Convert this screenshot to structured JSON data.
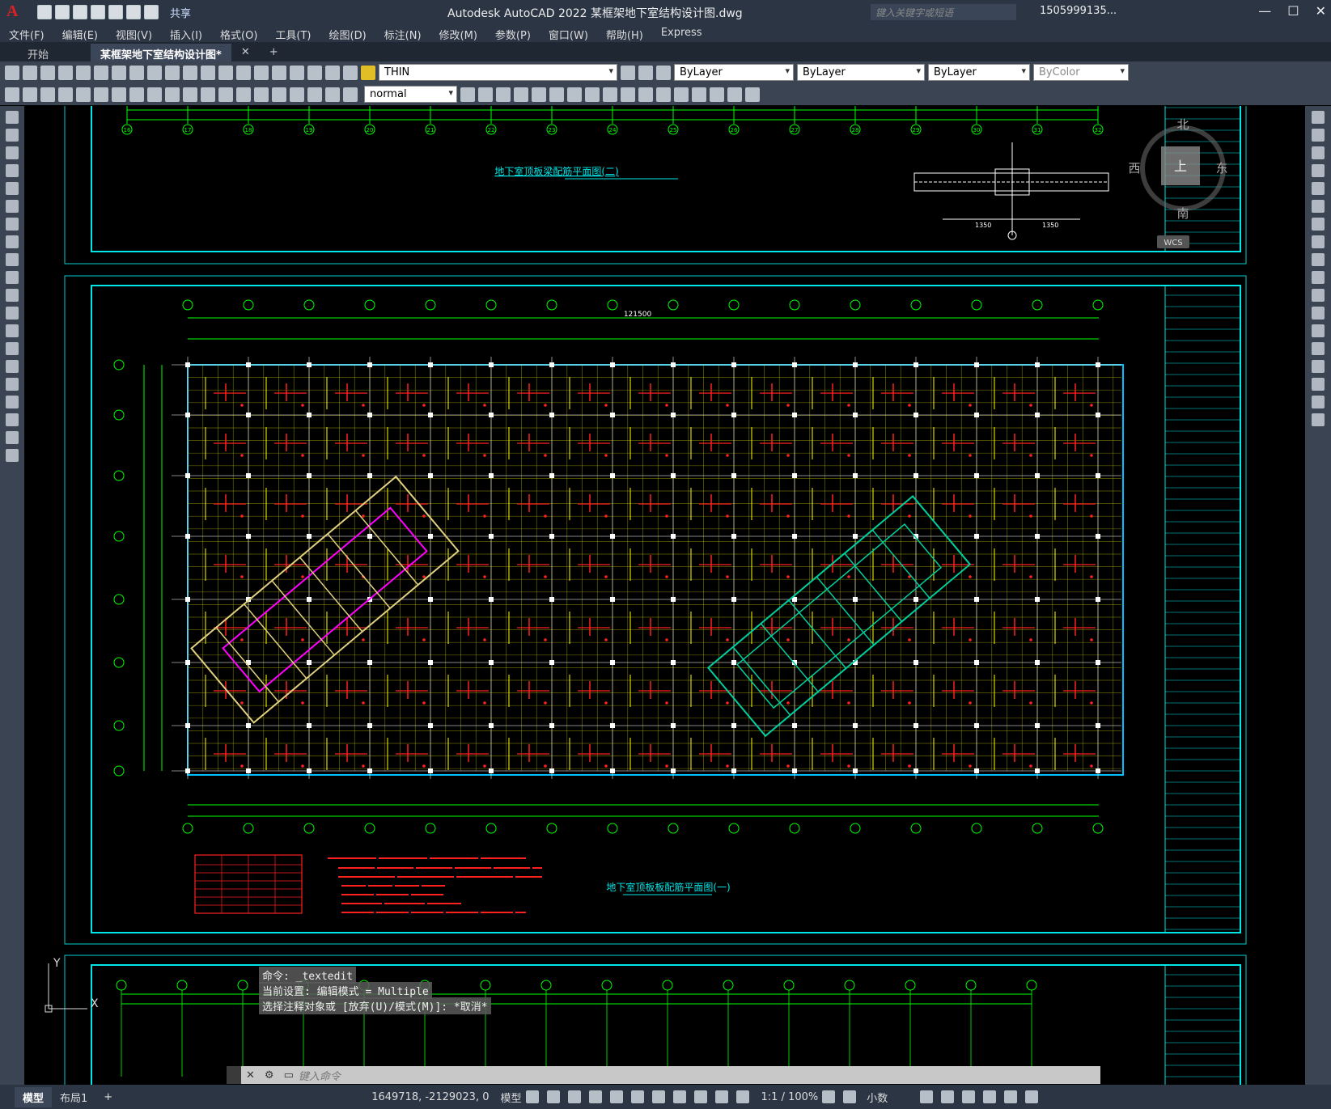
{
  "app": {
    "title": "Autodesk AutoCAD 2022    某框架地下室结构设计图.dwg",
    "share_label": "共享",
    "search_placeholder": "键入关键字或短语",
    "user": "1505999135..."
  },
  "menu": [
    "文件(F)",
    "编辑(E)",
    "视图(V)",
    "插入(I)",
    "格式(O)",
    "工具(T)",
    "绘图(D)",
    "标注(N)",
    "修改(M)",
    "参数(P)",
    "窗口(W)",
    "帮助(H)",
    "Express"
  ],
  "tabs": [
    {
      "label": "开始"
    },
    {
      "label": "某框架地下室结构设计图*"
    }
  ],
  "toolbar": {
    "layer": "THIN",
    "text_style": "normal",
    "color": "ByLayer",
    "linetype": "ByLayer",
    "lineweight": "ByLayer",
    "plotstyle": "ByColor"
  },
  "drawing": {
    "title1": "地下室顶板梁配筋平面图(二)",
    "title2": "地下室顶板板配筋平面图(一)",
    "dim_total": "121500",
    "axis_labels_top": [
      "16",
      "17",
      "18",
      "19",
      "20",
      "21",
      "22",
      "23",
      "24",
      "25",
      "26",
      "27",
      "28",
      "29",
      "30",
      "31",
      "32"
    ],
    "viewcube": {
      "north": "北",
      "south": "南",
      "east": "东",
      "west": "西",
      "top": "上",
      "wcs": "WCS"
    },
    "ucs": {
      "x": "X",
      "y": "Y"
    }
  },
  "command": {
    "history": [
      "命令: _textedit",
      "当前设置: 编辑模式 = Multiple",
      "选择注释对象或 [放弃(U)/模式(M)]: *取消*"
    ],
    "placeholder": "键入命令"
  },
  "status": {
    "tab_model": "模型",
    "tab_layout": "布局1",
    "coords": "1649718, -2129023, 0",
    "space": "模型",
    "scale": "1:1 / 100%",
    "units": "小数"
  }
}
